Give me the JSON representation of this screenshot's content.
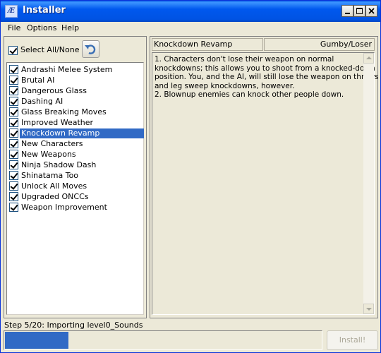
{
  "window": {
    "title": "Installer",
    "icon": "ae-app-icon"
  },
  "menu": {
    "items": [
      {
        "label": "File"
      },
      {
        "label": "Options"
      },
      {
        "label": "Help"
      }
    ]
  },
  "left": {
    "select_all_label": "Select All/None",
    "select_all_checked": true,
    "undo_icon": "undo-icon",
    "mods": [
      {
        "label": "Andrashi Melee System",
        "checked": true
      },
      {
        "label": "Brutal AI",
        "checked": true
      },
      {
        "label": "Dangerous Glass",
        "checked": true
      },
      {
        "label": "Dashing AI",
        "checked": true
      },
      {
        "label": "Glass Breaking Moves",
        "checked": true
      },
      {
        "label": "Improved Weather",
        "checked": true
      },
      {
        "label": "Knockdown Revamp",
        "checked": true,
        "selected": true
      },
      {
        "label": "New Characters",
        "checked": true
      },
      {
        "label": "New Weapons",
        "checked": true
      },
      {
        "label": "Ninja Shadow Dash",
        "checked": true
      },
      {
        "label": "Shinatama Too",
        "checked": true
      },
      {
        "label": "Unlock All Moves",
        "checked": true
      },
      {
        "label": "Upgraded ONCCs",
        "checked": true
      },
      {
        "label": "Weapon Improvement",
        "checked": true
      }
    ]
  },
  "detail": {
    "title": "Knockdown Revamp",
    "author": "Gumby/Loser",
    "description_lines": [
      "1. Characters don't lose their weapon on normal",
      "knockdowns; this allows you to shoot from a knocked-down",
      "position. You, and the AI, will still lose the weapon on throws",
      "and leg sweep knockdowns, however.",
      "2. Blownup enemies can knock other people down."
    ]
  },
  "status": {
    "text": "Step 5/20: Importing level0_Sounds",
    "progress": 0.2,
    "install_label": "Install!",
    "install_enabled": false
  },
  "colors": {
    "title_bar": "#0054e3",
    "selection": "#316ac5",
    "progress": "#316ac5",
    "face": "#ece9d8"
  }
}
